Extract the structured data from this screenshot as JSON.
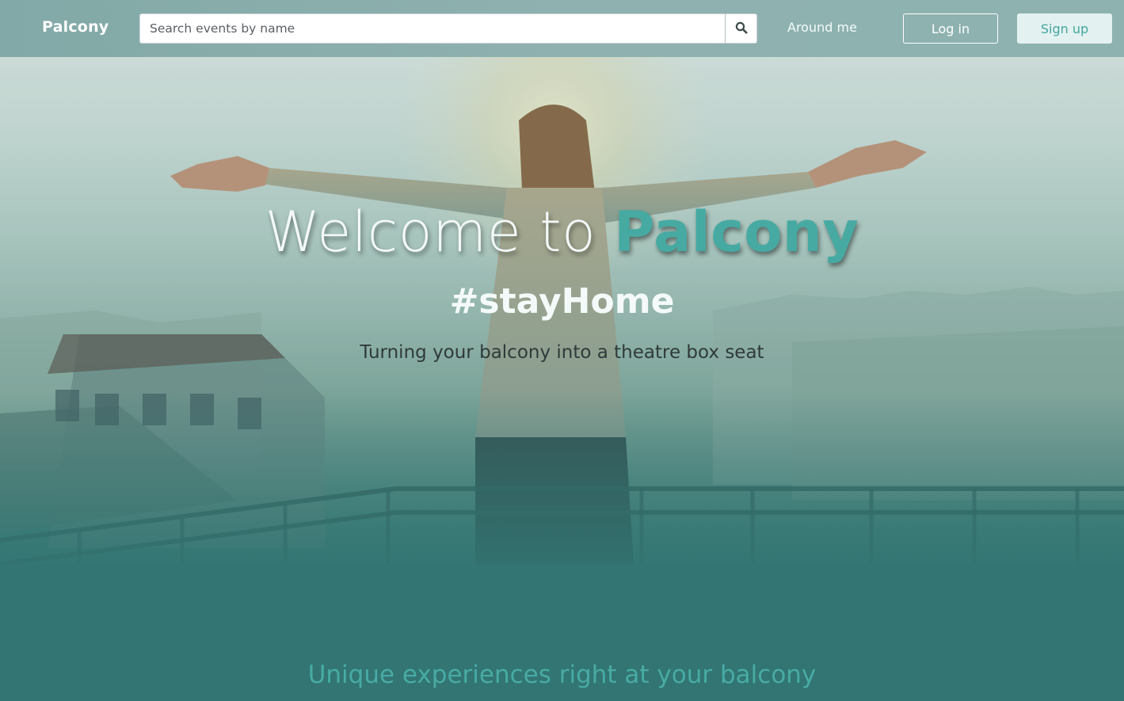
{
  "navbar": {
    "brand": "Palcony",
    "search_placeholder": "Search events by name",
    "search_icon": "search-icon",
    "around_me": "Around me",
    "login": "Log in",
    "signup": "Sign up"
  },
  "hero": {
    "title_prefix": "Welcome to ",
    "title_accent": "Palcony",
    "tagline": "#stayHome",
    "subtitle": "Turning your balcony into a theatre box seat"
  },
  "section": {
    "heading": "Unique experiences right at your balcony"
  },
  "colors": {
    "accent": "#46aaa2",
    "navbar": "#8fb1af",
    "hero_bottom": "#327572",
    "signup_bg": "#e3f1f0"
  }
}
